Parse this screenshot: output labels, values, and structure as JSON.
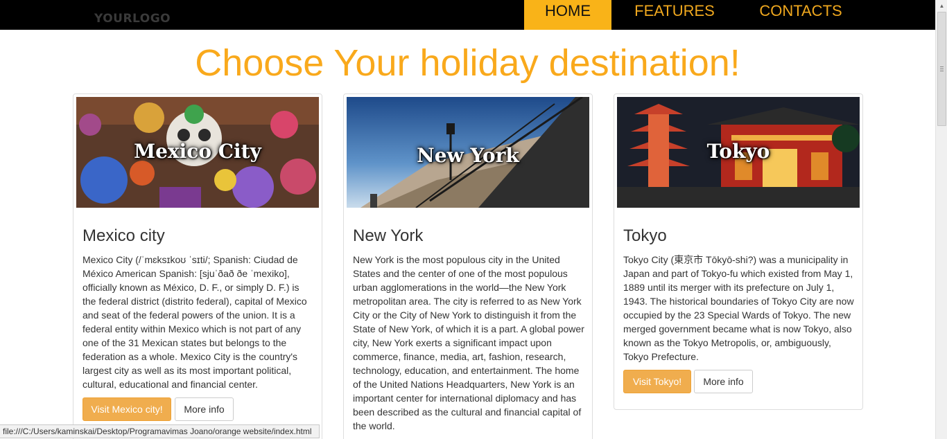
{
  "header": {
    "logo": "YOURLOGO",
    "nav": [
      {
        "label": "HOME",
        "active": true
      },
      {
        "label": "FEATURES",
        "active": false
      },
      {
        "label": "CONTACTS",
        "active": false
      }
    ]
  },
  "main": {
    "title": "Choose Your holiday destination!",
    "cards": [
      {
        "image_label": "Mexico City",
        "title": "Mexico city",
        "text": "Mexico City (/ˈmɛksɪkoʊ ˈsɪti/; Spanish: Ciudad de México American Spanish: [sjuˈðað ðe ˈmexiko], officially known as México, D. F., or simply D. F.) is the federal district (distrito federal), capital of Mexico and seat of the federal powers of the union. It is a federal entity within Mexico which is not part of any one of the 31 Mexican states but belongs to the federation as a whole. Mexico City is the country's largest city as well as its most important political, cultural, educational and financial center.",
        "primary_button": "Visit Mexico city!",
        "secondary_button": "More info"
      },
      {
        "image_label": "New York",
        "title": "New York",
        "text": "New York is the most populous city in the United States and the center of one of the most populous urban agglomerations in the world—the New York metropolitan area. The city is referred to as New York City or the City of New York to distinguish it from the State of New York, of which it is a part. A global power city, New York exerts a significant impact upon commerce, finance, media, art, fashion, research, technology, education, and entertainment. The home of the United Nations Headquarters, New York is an important center for international diplomacy and has been described as the cultural and financial capital of the world."
      },
      {
        "image_label": "Tokyo",
        "title": "Tokyo",
        "text": "Tokyo City (東京市 Tōkyō-shi?) was a municipality in Japan and part of Tokyo-fu which existed from May 1, 1889 until its merger with its prefecture on July 1, 1943. The historical boundaries of Tokyo City are now occupied by the 23 Special Wards of Tokyo. The new merged government became what is now Tokyo, also known as the Tokyo Metropolis, or, ambiguously, Tokyo Prefecture.",
        "primary_button": "Visit Tokyo!",
        "secondary_button": "More info"
      }
    ]
  },
  "status_bar": {
    "url": "file:///C:/Users/kaminskai/Desktop/Programavimas Joano/orange website/index.html"
  },
  "colors": {
    "accent": "#f9b318",
    "title": "#f9a91c",
    "button": "#f0ad4e",
    "navbar": "#000000"
  }
}
